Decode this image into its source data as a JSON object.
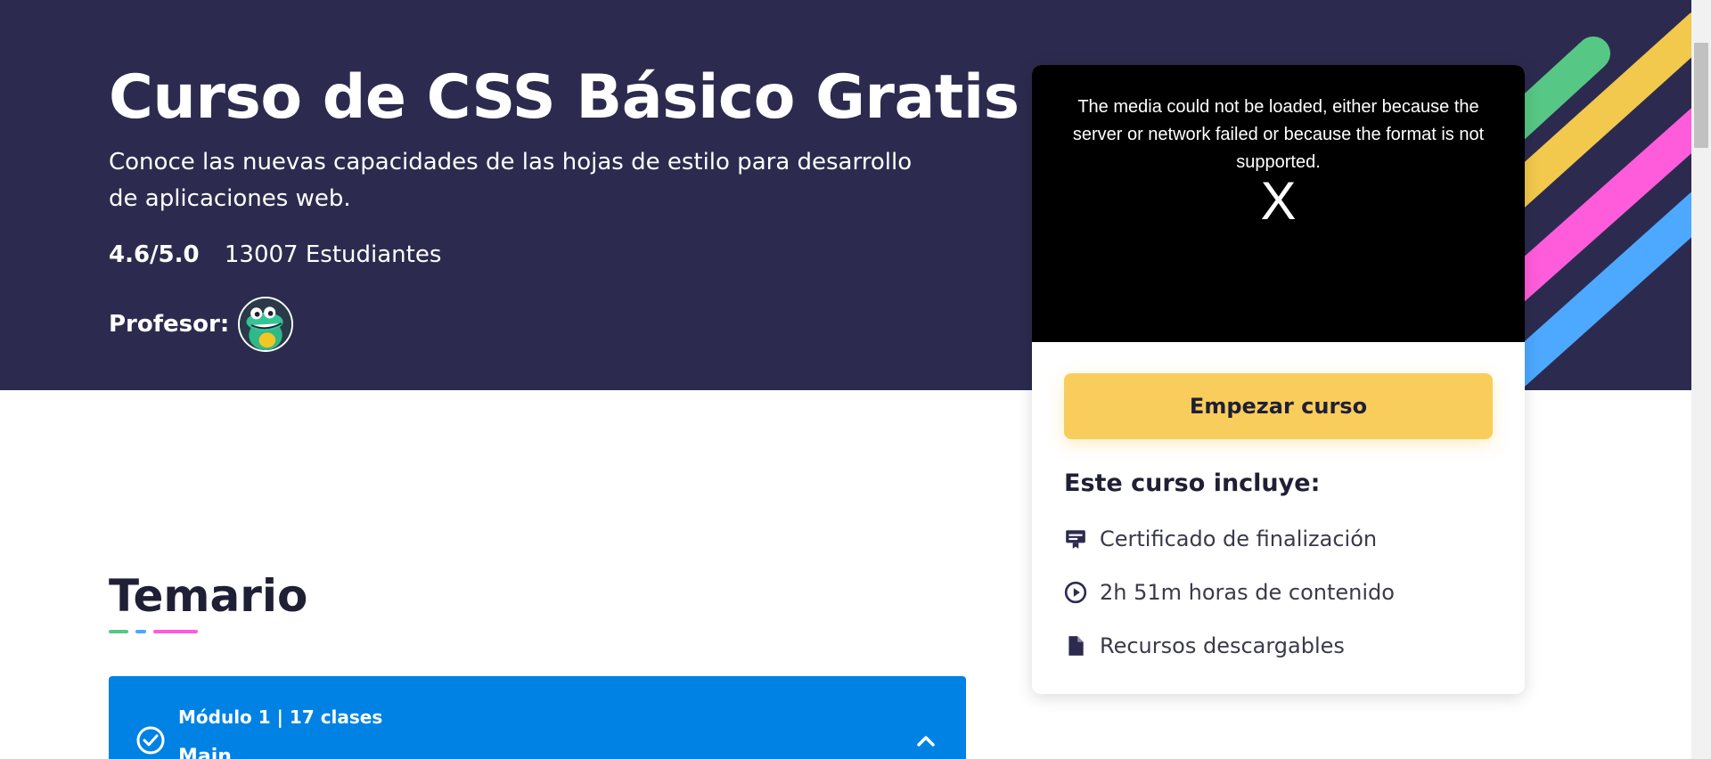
{
  "course": {
    "title": "Curso de CSS Básico Gratis",
    "subtitle": "Conoce las nuevas capacidades de las hojas de estilo para desarrollo de aplicaciones web.",
    "rating": "4.6/5.0",
    "students": "13007 Estudiantes",
    "teacher_label": "Profesor:"
  },
  "video": {
    "error_message": "The media could not be loaded, either because the server or network failed or because the format is not supported.",
    "close_symbol": "X"
  },
  "card": {
    "start_button": "Empezar curso",
    "includes_title": "Este curso incluye:",
    "includes": [
      {
        "icon": "certificate-icon",
        "label": "Certificado de finalización"
      },
      {
        "icon": "play-circle-icon",
        "label": "2h 51m  horas de contenido"
      },
      {
        "icon": "document-icon",
        "label": "Recursos descargables"
      }
    ]
  },
  "syllabus": {
    "title": "Temario",
    "modules": [
      {
        "meta": "Módulo 1  |  17 clases",
        "name": "Main"
      }
    ]
  },
  "colors": {
    "hero_bg": "#2c2b4f",
    "accent_yellow": "#f9cd5b",
    "module_blue": "#0082e4",
    "stripe_green": "#57c785",
    "stripe_yellow": "#f2c94c",
    "stripe_pink": "#ff5cdb",
    "stripe_blue": "#4da8ff"
  }
}
